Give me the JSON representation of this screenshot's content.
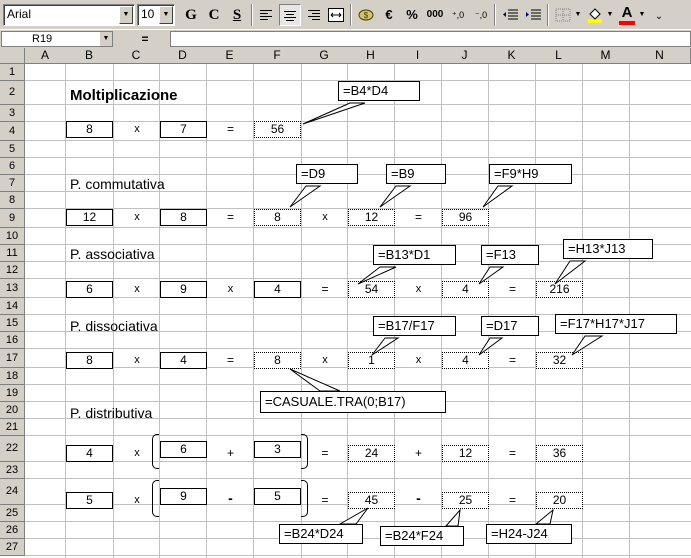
{
  "toolbar": {
    "font_name": "Arial",
    "font_size": "10",
    "bold": "G",
    "italic": "C",
    "underline": "S",
    "euro": "€",
    "percent": "%",
    "thousands": "000",
    "inc_decimal": "⁺,0",
    "dec_decimal": "⁻,0",
    "font_color_letter": "A",
    "colors": {
      "fill": "#ffff00",
      "font": "#ff0000"
    }
  },
  "formula_bar": {
    "name_box": "R19",
    "equals": "=",
    "content": ""
  },
  "columns": [
    "A",
    "B",
    "C",
    "D",
    "E",
    "F",
    "G",
    "H",
    "I",
    "J",
    "K",
    "L",
    "M",
    "N"
  ],
  "rows": [
    "1",
    "2",
    "3",
    "4",
    "5",
    "6",
    "7",
    "8",
    "9",
    "10",
    "11",
    "12",
    "13",
    "14",
    "15",
    "16",
    "17",
    "18",
    "19",
    "20",
    "21",
    "22",
    "23",
    "24",
    "25",
    "26",
    "27"
  ],
  "sheet": {
    "moltiplicazione": {
      "title": "Moltiplicazione",
      "a": "8",
      "x": "x",
      "b": "7",
      "eq": "=",
      "result": "56"
    },
    "commutativa": {
      "title": "P. commutativa",
      "a": "12",
      "x1": "x",
      "b": "8",
      "eq1": "=",
      "c": "8",
      "x2": "x",
      "d": "12",
      "eq2": "=",
      "result": "96"
    },
    "associativa": {
      "title": "P. associativa",
      "a": "6",
      "x1": "x",
      "b": "9",
      "x2": "x",
      "c": "4",
      "eq1": "=",
      "d": "54",
      "x3": "x",
      "e": "4",
      "eq2": "=",
      "result": "216"
    },
    "dissociativa": {
      "title": "P. dissociativa",
      "a": "8",
      "x1": "x",
      "b": "4",
      "eq1": "=",
      "c": "8",
      "x2": "x",
      "d": "1",
      "x3": "x",
      "e": "4",
      "eq2": "=",
      "result": "32"
    },
    "distributiva": {
      "title": "P. distributiva",
      "row22": {
        "a": "4",
        "x": "x",
        "b": "6",
        "plus": "+",
        "c": "3",
        "eq1": "=",
        "d": "24",
        "plus2": "+",
        "e": "12",
        "eq2": "=",
        "result": "36"
      },
      "row24": {
        "a": "5",
        "x": "x",
        "b": "9",
        "minus": "-",
        "c": "5",
        "eq1": "=",
        "d": "45",
        "minus2": "-",
        "e": "25",
        "eq2": "=",
        "result": "20"
      }
    }
  },
  "callouts": {
    "b4d4": "=B4*D4",
    "d9": "=D9",
    "b9": "=B9",
    "f9h9": "=F9*H9",
    "b13d1": "=B13*D1",
    "f13": "=F13",
    "h13j13": "=H13*J13",
    "b17f17": "=B17/F17",
    "d17": "=D17",
    "f17h17j17": "=F17*H17*J17",
    "casuale": "=CASUALE.TRA(0;B17)",
    "b24d24": "=B24*D24",
    "b24f24": "=B24*F24",
    "h24j24": "=H24-J24"
  }
}
